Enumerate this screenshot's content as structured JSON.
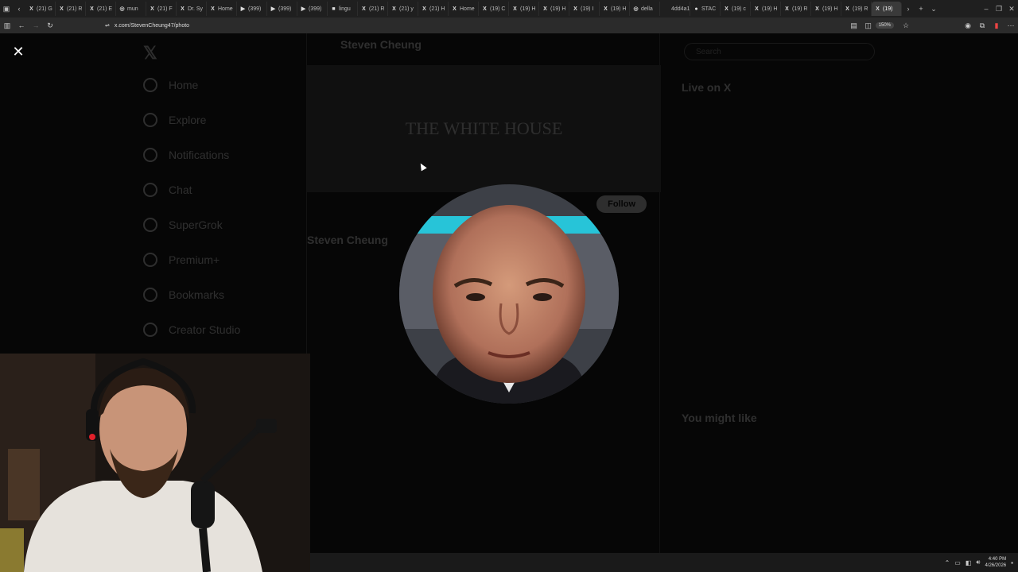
{
  "browser": {
    "tabs": [
      {
        "icon": "X",
        "label": "(21) G"
      },
      {
        "icon": "X",
        "label": "(21) R"
      },
      {
        "icon": "X",
        "label": "(21) E"
      },
      {
        "icon": "◎",
        "label": "mun"
      },
      {
        "icon": "X",
        "label": "(21) F"
      },
      {
        "icon": "X",
        "label": "Dr. Sy"
      },
      {
        "icon": "X",
        "label": "Home"
      },
      {
        "icon": "▶",
        "label": "(399)"
      },
      {
        "icon": "▶",
        "label": "(399)"
      },
      {
        "icon": "▶",
        "label": "(399)"
      },
      {
        "icon": "■",
        "label": "lingu"
      },
      {
        "icon": "X",
        "label": "(21) R"
      },
      {
        "icon": "X",
        "label": "(21) y"
      },
      {
        "icon": "X",
        "label": "(21) H"
      },
      {
        "icon": "X",
        "label": "Home"
      },
      {
        "icon": "X",
        "label": "(19) C"
      },
      {
        "icon": "X",
        "label": "(19) H"
      },
      {
        "icon": "X",
        "label": "(19) H"
      },
      {
        "icon": "X",
        "label": "(19) I"
      },
      {
        "icon": "X",
        "label": "(19) H"
      },
      {
        "icon": "◎",
        "label": "della"
      },
      {
        "icon": "",
        "label": "4dd4a14"
      },
      {
        "icon": "●",
        "label": "STAC"
      },
      {
        "icon": "X",
        "label": "(19) c"
      },
      {
        "icon": "X",
        "label": "(19) H"
      },
      {
        "icon": "X",
        "label": "(19) R"
      },
      {
        "icon": "X",
        "label": "(19) H"
      },
      {
        "icon": "X",
        "label": "(19) R"
      },
      {
        "icon": "X",
        "label": "(19)"
      }
    ],
    "active_tab_index": 28,
    "url": "x.com/StevenCheung47/photo",
    "zoom": "150%"
  },
  "page": {
    "nav_items": [
      "Home",
      "Explore",
      "Notifications",
      "Chat",
      "SuperGrok",
      "Premium+",
      "Bookmarks",
      "Creator Studio"
    ],
    "profile_name": "Steven Cheung",
    "banner_text": "THE WHITE HOUSE",
    "follow_label": "Follow",
    "right_search": "Search",
    "live_heading": "Live on X",
    "suggest_heading": "You might like"
  },
  "taskbar": {
    "time": "4:40 PM",
    "date": "4/26/2026"
  }
}
